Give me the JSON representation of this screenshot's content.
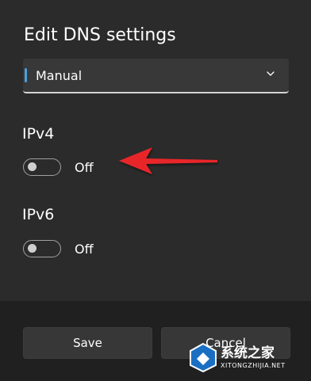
{
  "dialog": {
    "title": "Edit DNS settings",
    "dropdown": {
      "selected": "Manual"
    },
    "ipv4": {
      "label": "IPv4",
      "state_text": "Off",
      "enabled": false
    },
    "ipv6": {
      "label": "IPv6",
      "state_text": "Off",
      "enabled": false
    },
    "buttons": {
      "save": "Save",
      "cancel": "Cancel"
    }
  },
  "annotation": {
    "arrow_color": "#e8262b",
    "icon": "arrow-left-icon"
  },
  "watermark": {
    "text": "系统之家",
    "sub": "XITONGZHIJIA.NET"
  },
  "colors": {
    "background": "#2b2b2b",
    "footer": "#202020",
    "accent": "#4ca0e0"
  }
}
